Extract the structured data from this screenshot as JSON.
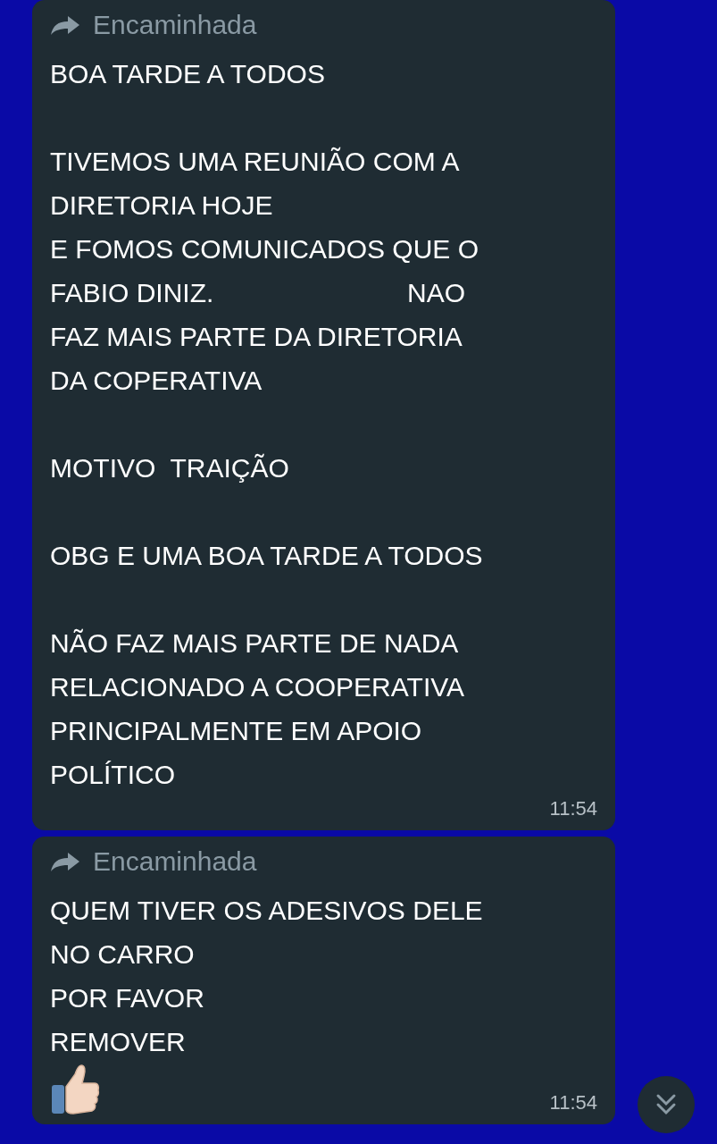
{
  "messages": [
    {
      "forwarded_label": "Encaminhada",
      "text": "BOA TARDE A TODOS\n\nTIVEMOS UMA REUNIÃO COM A\nDIRETORIA HOJE\nE FOMOS COMUNICADOS QUE O\nFABIO DINIZ.                          NAO\nFAZ MAIS PARTE DA DIRETORIA\nDA COPERATIVA\n\nMOTIVO  TRAIÇÃO\n\nOBG E UMA BOA TARDE A TODOS\n\nNÃO FAZ MAIS PARTE DE NADA\nRELACIONADO A COOPERATIVA\nPRINCIPALMENTE EM APOIO\nPOLÍTICO",
      "thumbs_up": false,
      "time": "11:54"
    },
    {
      "forwarded_label": "Encaminhada",
      "text": "QUEM TIVER OS ADESIVOS DELE\nNO CARRO\nPOR FAVOR\nREMOVER",
      "thumbs_up": true,
      "time": "11:54"
    }
  ]
}
